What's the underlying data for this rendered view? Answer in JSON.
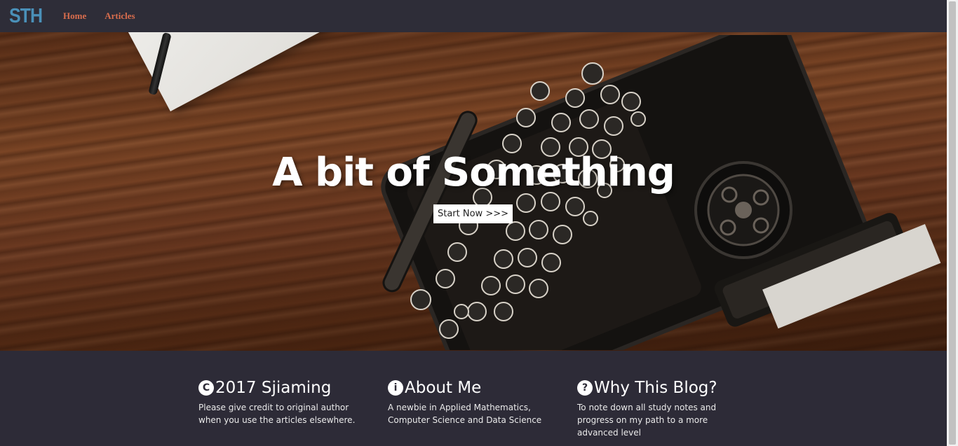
{
  "nav": {
    "brand": "STH",
    "links": [
      "Home",
      "Articles"
    ]
  },
  "hero": {
    "title": "A bit of Something",
    "button_label": "Start Now >>>"
  },
  "footer": {
    "columns": [
      {
        "icon": "copyright-icon",
        "glyph": "C",
        "title": "2017 Sjiaming",
        "text": "Please give credit to original author when you use the articles elsewhere."
      },
      {
        "icon": "info-icon",
        "glyph": "i",
        "title": "About Me",
        "text": "A newbie in Applied Mathematics, Computer Science and Data Science"
      },
      {
        "icon": "question-icon",
        "glyph": "?",
        "title": "Why This Blog?",
        "text": "To note down all study notes and progress on my path to a more advanced level"
      }
    ]
  },
  "colors": {
    "background": "#2d2b37",
    "brand": "#4a90b8",
    "nav_link": "#d96d4d",
    "text": "#ffffff"
  }
}
